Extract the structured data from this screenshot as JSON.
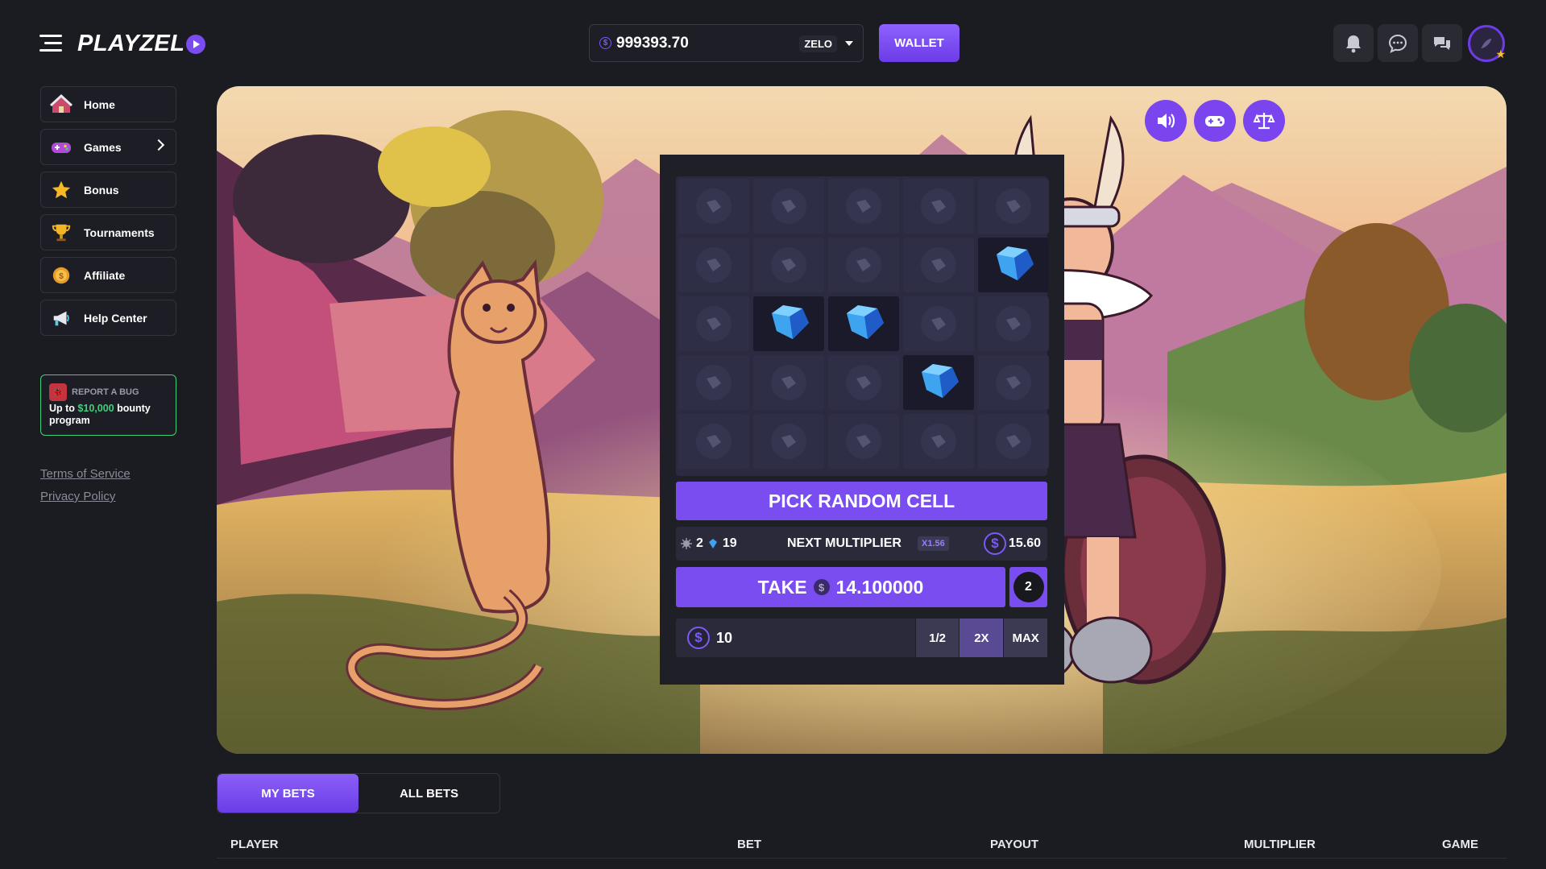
{
  "brand": {
    "logo_text": "PLAYZEL"
  },
  "header": {
    "balance": "999393.70",
    "currency": "ZELO",
    "wallet_label": "WALLET",
    "icons": [
      "bell-icon",
      "chat-icon",
      "messages-icon"
    ]
  },
  "sidebar": {
    "items": [
      {
        "label": "Home",
        "icon": "home-icon"
      },
      {
        "label": "Games",
        "icon": "gamepad-icon"
      },
      {
        "label": "Bonus",
        "icon": "star-icon"
      },
      {
        "label": "Tournaments",
        "icon": "trophy-icon"
      },
      {
        "label": "Affiliate",
        "icon": "coin-icon"
      },
      {
        "label": "Help Center",
        "icon": "megaphone-icon"
      }
    ],
    "bug_card": {
      "title": "REPORT A BUG",
      "text_prefix": "Up to ",
      "amount": "$10,000",
      "text_suffix": " bounty program"
    },
    "terms": "Terms of Service",
    "privacy": "Privacy Policy"
  },
  "game": {
    "controls": [
      "sound-icon",
      "gamepad-icon",
      "fairness-scale-icon"
    ],
    "grid": [
      [
        "hidden",
        "hidden",
        "hidden",
        "hidden",
        "hidden"
      ],
      [
        "hidden",
        "hidden",
        "hidden",
        "hidden",
        "gem"
      ],
      [
        "hidden",
        "gem",
        "gem",
        "hidden",
        "hidden"
      ],
      [
        "hidden",
        "hidden",
        "hidden",
        "gem",
        "hidden"
      ],
      [
        "hidden",
        "hidden",
        "hidden",
        "hidden",
        "hidden"
      ]
    ],
    "random_label": "PICK RANDOM CELL",
    "mines_count": "2",
    "gems_count": "19",
    "next_label": "NEXT MULTIPLIER",
    "next_multiplier": "X1.56",
    "next_amount": "15.60",
    "take_label": "TAKE",
    "take_amount": "14.100000",
    "mines_setting": "2",
    "bet_amount": "10",
    "half_label": "1/2",
    "double_label": "2X",
    "max_label": "MAX",
    "coin_symbol": "$"
  },
  "bets": {
    "tabs": [
      "MY BETS",
      "ALL BETS"
    ],
    "columns": [
      "PLAYER",
      "BET",
      "PAYOUT",
      "MULTIPLIER",
      "GAME"
    ]
  },
  "colors": {
    "accent": "#7a4df0",
    "bg": "#1b1b22",
    "green": "#3fd07a"
  }
}
